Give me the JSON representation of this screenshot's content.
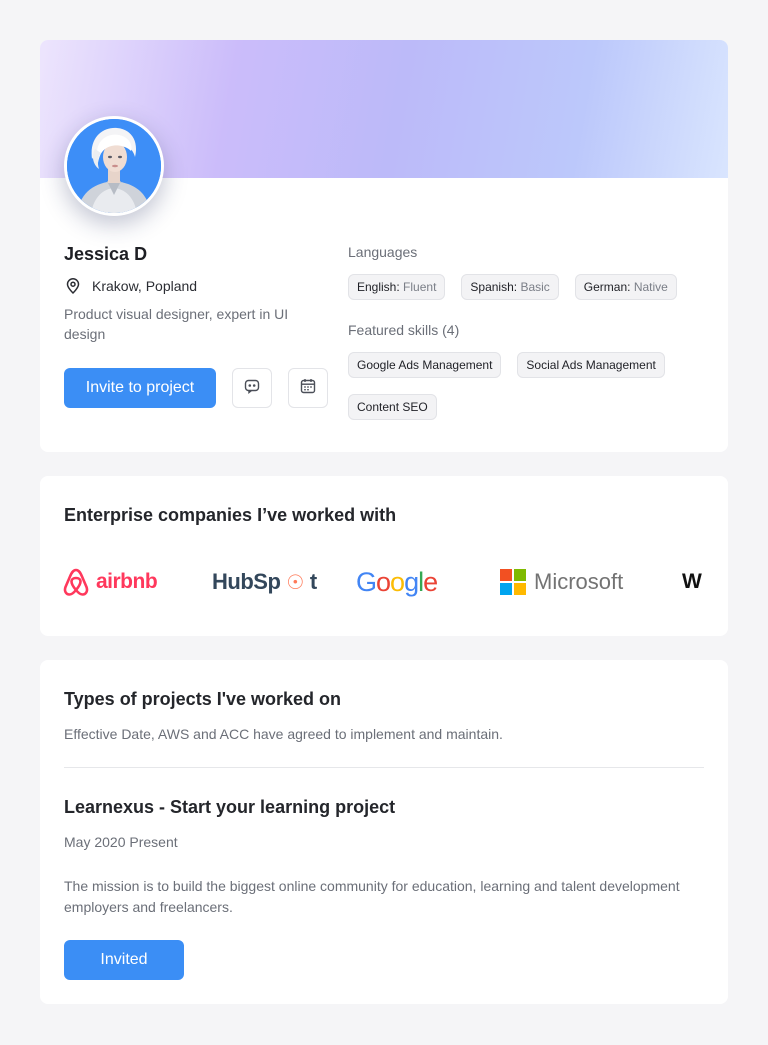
{
  "profile": {
    "name": "Jessica D",
    "location": "Krakow, Popland",
    "bio": "Product visual designer, expert in UI design",
    "invite_label": "Invite to project",
    "icons": {
      "location": "map-pin-icon",
      "chat": "chat-icon",
      "calendar": "calendar-icon"
    },
    "languages_label": "Languages",
    "languages": [
      {
        "language": "English:",
        "level": "Fluent"
      },
      {
        "language": "Spanish:",
        "level": "Basic"
      },
      {
        "language": "German:",
        "level": "Native"
      }
    ],
    "skills_label": "Featured skills (4)",
    "skills": [
      "Google Ads Management",
      "Social Ads Management",
      "Content SEO"
    ]
  },
  "companies": {
    "title": "Enterprise companies I’ve worked with",
    "logos": [
      {
        "name": "airbnb",
        "text": "airbnb",
        "color": "#FF385C"
      },
      {
        "name": "hubspot",
        "text_a": "HubSp",
        "text_b": "t",
        "color": "#33475B",
        "accent": "#FF7A59"
      },
      {
        "name": "google",
        "letters": [
          "G",
          "o",
          "o",
          "g",
          "l",
          "e"
        ],
        "colors": [
          "#4285F4",
          "#EA4335",
          "#FBBC05",
          "#4285F4",
          "#34A853",
          "#EA4335"
        ]
      },
      {
        "name": "microsoft",
        "text": "Microsoft",
        "color": "#737373"
      },
      {
        "name": "partial",
        "text": "W"
      }
    ]
  },
  "projects": {
    "title": "Types of projects I've worked on",
    "description": "Effective Date, AWS and ACC have agreed to implement and maintain.",
    "project": {
      "name": "Learnexus - Start your learning project",
      "dates": "May 2020 Present",
      "mission": "The mission is to build the biggest online community for education, learning and talent development employers and freelancers.",
      "button_label": "Invited"
    }
  },
  "colors": {
    "accent": "#3B8EF5",
    "background": "#F5F5F7"
  }
}
